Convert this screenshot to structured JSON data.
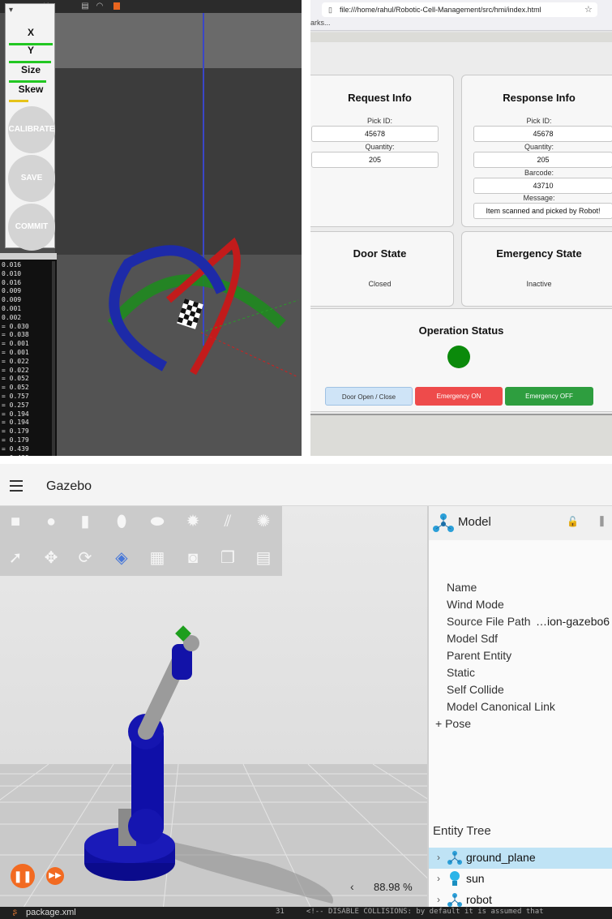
{
  "calibration": {
    "slider_labels": [
      "X",
      "Y",
      "Size",
      "Skew"
    ],
    "buttons": {
      "calibrate": "CALIBRATE",
      "save": "SAVE",
      "commit": "COMMIT"
    },
    "console_values": [
      "0.016",
      "0.010",
      "0.016",
      "0.009",
      "0.009",
      "0.001",
      "0.002",
      "= 0.030",
      "= 0.038",
      "= 0.001",
      "= 0.001",
      "= 0.022",
      "= 0.022",
      "= 0.052",
      "= 0.052",
      "= 0.757",
      "= 0.257",
      "= 0.194",
      "= 0.194",
      "= 0.179",
      "= 0.179",
      "= 0.439",
      "= 0.439"
    ]
  },
  "browser": {
    "url": "file:///home/rahul/Robotic-Cell-Management/src/hmi/index.html",
    "bookmarks": "arks...",
    "request_info": {
      "title": "Request Info",
      "pick_id_label": "Pick ID:",
      "pick_id": "45678",
      "quantity_label": "Quantity:",
      "quantity": "205"
    },
    "response_info": {
      "title": "Response Info",
      "pick_id_label": "Pick ID:",
      "pick_id": "45678",
      "quantity_label": "Quantity:",
      "quantity": "205",
      "barcode_label": "Barcode:",
      "barcode": "43710",
      "message_label": "Message:",
      "message": "Item scanned and picked by Robot!"
    },
    "door_state": {
      "title": "Door State",
      "value": "Closed"
    },
    "emergency_state": {
      "title": "Emergency State",
      "value": "Inactive"
    },
    "operation_status": {
      "title": "Operation Status",
      "indicator_color": "#0b8a0b"
    },
    "buttons": {
      "door": "Door Open / Close",
      "emergency_on": "Emergency ON",
      "emergency_off": "Emergency OFF"
    },
    "colors": {
      "door": "#cfe4f7",
      "emergency_on": "#ee4b4b",
      "emergency_off": "#2e9e3f"
    }
  },
  "gazebo": {
    "title": "Gazebo",
    "model": {
      "title": "Model",
      "properties": [
        "Name",
        "Wind Mode",
        "Source File Path",
        "Model Sdf",
        "Parent Entity",
        "Static",
        "Self Collide",
        "Model Canonical Link",
        "+ Pose"
      ],
      "source_file_value": "…ion-gazebo6"
    },
    "entity_tree": {
      "title": "Entity Tree",
      "items": [
        "ground_plane",
        "sun",
        "robot"
      ],
      "selected": "ground_plane"
    },
    "zoom": "88.98 %",
    "status_file": "package.xml",
    "status_line": "31     <!-- DISABLE COLLISIONS: by default it is assumed that"
  }
}
